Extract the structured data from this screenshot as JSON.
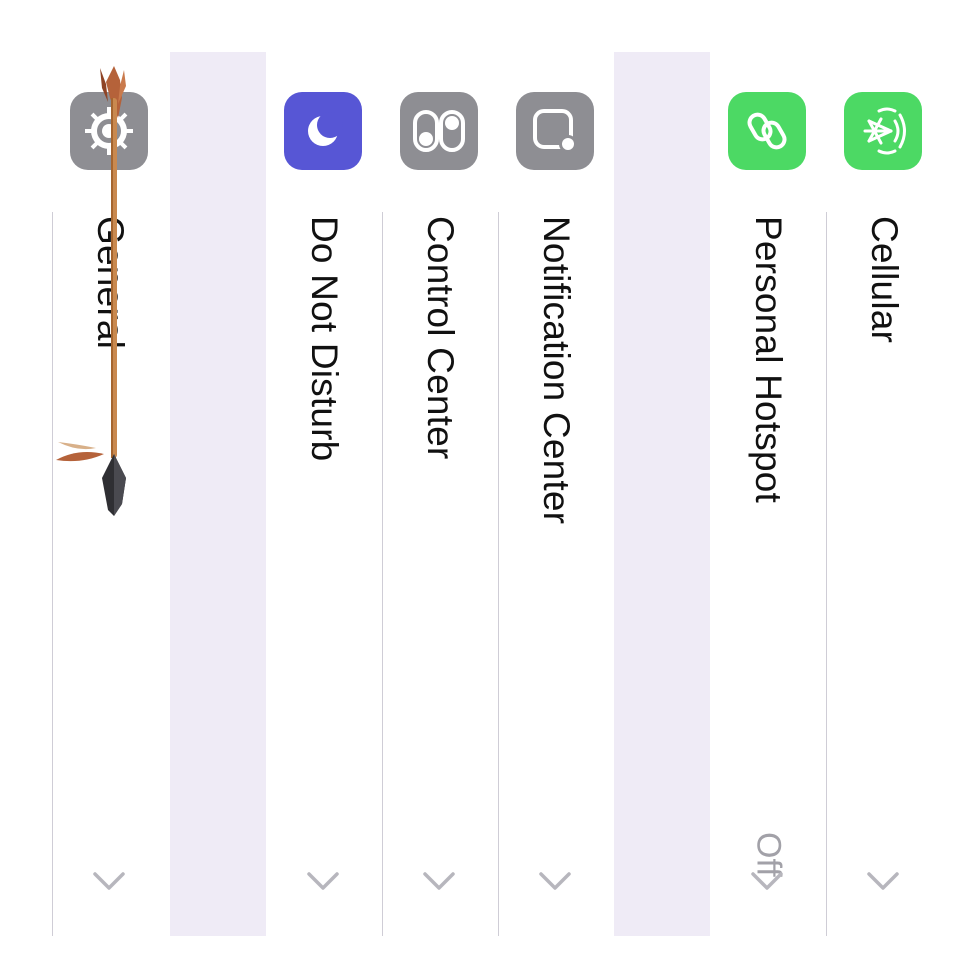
{
  "settings": {
    "rows": [
      {
        "label": "General",
        "icon": "gear-icon",
        "color": "#8e8e93"
      },
      {
        "label": "Do Not Disturb",
        "icon": "moon-icon",
        "color": "#5756d5"
      },
      {
        "label": "Control Center",
        "icon": "toggles-icon",
        "color": "#8e8e93"
      },
      {
        "label": "Notification Center",
        "icon": "notification-icon",
        "color": "#8e8e93"
      },
      {
        "label": "Personal Hotspot",
        "value": "Off",
        "icon": "link-icon",
        "color": "#4cd964"
      },
      {
        "label": "Cellular",
        "icon": "antenna-icon",
        "color": "#4cd964"
      }
    ]
  },
  "colors": {
    "background": "#ffffff",
    "group_gap": "#efebf6",
    "separator": "#cfcdd6",
    "chevron": "#b7b6bd",
    "value_text": "#a2a1a8"
  }
}
